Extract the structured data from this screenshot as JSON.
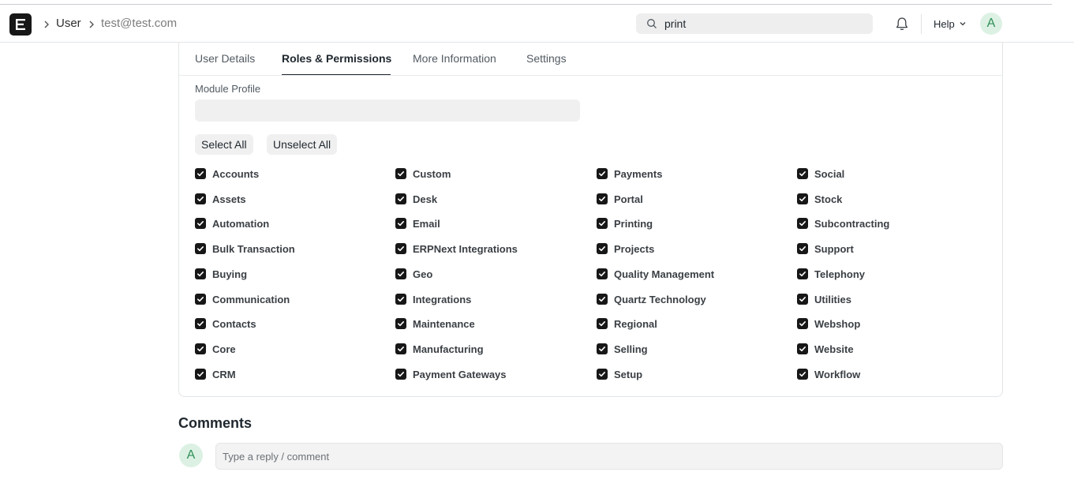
{
  "breadcrumb": {
    "doctype": "User",
    "record": "test@test.com"
  },
  "search": {
    "value": "print"
  },
  "navbar": {
    "help_label": "Help",
    "avatar_initial": "A"
  },
  "tabs": [
    {
      "label": "User Details",
      "active": false
    },
    {
      "label": "Roles & Permissions",
      "active": true
    },
    {
      "label": "More Information",
      "active": false
    },
    {
      "label": "Settings",
      "active": false
    }
  ],
  "module_profile": {
    "label": "Module Profile",
    "value": ""
  },
  "buttons": {
    "select_all": "Select All",
    "unselect_all": "Unselect All"
  },
  "modules": {
    "col1": [
      "Accounts",
      "Assets",
      "Automation",
      "Bulk Transaction",
      "Buying",
      "Communication",
      "Contacts",
      "Core",
      "CRM"
    ],
    "col2": [
      "Custom",
      "Desk",
      "Email",
      "ERPNext Integrations",
      "Geo",
      "Integrations",
      "Maintenance",
      "Manufacturing",
      "Payment Gateways"
    ],
    "col3": [
      "Payments",
      "Portal",
      "Printing",
      "Projects",
      "Quality Management",
      "Quartz Technology",
      "Regional",
      "Selling",
      "Setup"
    ],
    "col4": [
      "Social",
      "Stock",
      "Subcontracting",
      "Support",
      "Telephony",
      "Utilities",
      "Webshop",
      "Website",
      "Workflow"
    ],
    "all_checked": true
  },
  "comments": {
    "title": "Comments",
    "avatar_initial": "A",
    "placeholder": "Type a reply / comment"
  },
  "colors": {
    "brand": "#171717",
    "avatar_bg": "#dcf1e4",
    "avatar_fg": "#2f8f57"
  }
}
